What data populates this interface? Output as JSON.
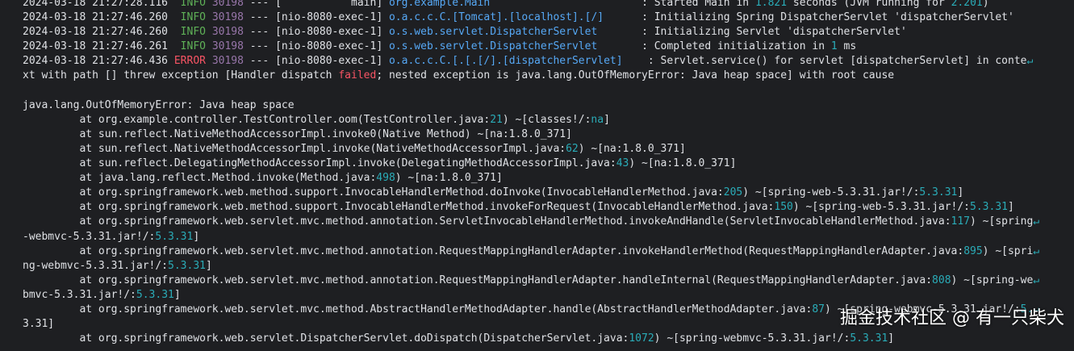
{
  "console": {
    "lines": [
      {
        "kind": "log",
        "ts": "2024-03-18 21:27:28.116",
        "level": "INFO",
        "pid": "30198",
        "thread": "--- [           main]",
        "logger": "org.example.Main",
        "pad": "                        ",
        "msg": ": Started Main in 1.821 seconds (JVM running for 2.201)"
      },
      {
        "kind": "log",
        "ts": "2024-03-18 21:27:46.260",
        "level": "INFO",
        "pid": "30198",
        "thread": "--- [nio-8080-exec-1]",
        "logger": "o.a.c.c.C.[Tomcat].[localhost].[/]",
        "pad": "      ",
        "msg": ": Initializing Spring DispatcherServlet 'dispatcherServlet'"
      },
      {
        "kind": "log",
        "ts": "2024-03-18 21:27:46.260",
        "level": "INFO",
        "pid": "30198",
        "thread": "--- [nio-8080-exec-1]",
        "logger": "o.s.web.servlet.DispatcherServlet",
        "pad": "       ",
        "msg": ": Initializing Servlet 'dispatcherServlet'"
      },
      {
        "kind": "log",
        "ts": "2024-03-18 21:27:46.261",
        "level": "INFO",
        "pid": "30198",
        "thread": "--- [nio-8080-exec-1]",
        "logger": "o.s.web.servlet.DispatcherServlet",
        "pad": "       ",
        "msg": ": Completed initialization in 1 ms"
      },
      {
        "kind": "log",
        "ts": "2024-03-18 21:27:46.436",
        "level": "ERROR",
        "pid": "30198",
        "thread": "--- [nio-8080-exec-1]",
        "logger": "o.a.c.c.C.[.[.[/].[dispatcherServlet]",
        "pad": "    ",
        "msg": ": Servlet.service() for servlet [dispatcherServlet] in conte"
      },
      {
        "kind": "text",
        "text": "xt with path [] threw exception [Handler dispatch failed; nested exception is java.lang.OutOfMemoryError: Java heap space] with root cause"
      },
      {
        "kind": "text",
        "text": ""
      },
      {
        "kind": "text",
        "text": "java.lang.OutOfMemoryError: Java heap space"
      },
      {
        "kind": "text",
        "text": "\tat org.example.controller.TestController.oom(TestController.java:21) ~[classes!/:na]"
      },
      {
        "kind": "text",
        "text": "\tat sun.reflect.NativeMethodAccessorImpl.invoke0(Native Method) ~[na:1.8.0_371]"
      },
      {
        "kind": "text",
        "text": "\tat sun.reflect.NativeMethodAccessorImpl.invoke(NativeMethodAccessorImpl.java:62) ~[na:1.8.0_371]"
      },
      {
        "kind": "text",
        "text": "\tat sun.reflect.DelegatingMethodAccessorImpl.invoke(DelegatingMethodAccessorImpl.java:43) ~[na:1.8.0_371]"
      },
      {
        "kind": "text",
        "text": "\tat java.lang.reflect.Method.invoke(Method.java:498) ~[na:1.8.0_371]"
      },
      {
        "kind": "text",
        "text": "\tat org.springframework.web.method.support.InvocableHandlerMethod.doInvoke(InvocableHandlerMethod.java:205) ~[spring-web-5.3.31.jar!/:5.3.31]"
      },
      {
        "kind": "text",
        "text": "\tat org.springframework.web.method.support.InvocableHandlerMethod.invokeForRequest(InvocableHandlerMethod.java:150) ~[spring-web-5.3.31.jar!/:5.3.31]"
      },
      {
        "kind": "text",
        "text": "\tat org.springframework.web.servlet.mvc.method.annotation.ServletInvocableHandlerMethod.invokeAndHandle(ServletInvocableHandlerMethod.java:117) ~[spring"
      },
      {
        "kind": "cont",
        "text": "-webmvc-5.3.31.jar!/:5.3.31]"
      },
      {
        "kind": "text",
        "text": "\tat org.springframework.web.servlet.mvc.method.annotation.RequestMappingHandlerAdapter.invokeHandlerMethod(RequestMappingHandlerAdapter.java:895) ~[spri"
      },
      {
        "kind": "cont",
        "text": "ng-webmvc-5.3.31.jar!/:5.3.31]"
      },
      {
        "kind": "text",
        "text": "\tat org.springframework.web.servlet.mvc.method.annotation.RequestMappingHandlerAdapter.handleInternal(RequestMappingHandlerAdapter.java:808) ~[spring-we"
      },
      {
        "kind": "cont",
        "text": "bmvc-5.3.31.jar!/:5.3.31]"
      },
      {
        "kind": "text",
        "text": "\tat org.springframework.web.servlet.mvc.method.AbstractHandlerMethodAdapter.handle(AbstractHandlerMethodAdapter.java:87) ~[spring-webmvc-5.3.31.jar!/:5."
      },
      {
        "kind": "cont",
        "text": "3.31]"
      },
      {
        "kind": "text",
        "text": "\tat org.springframework.web.servlet.DispatcherServlet.doDispatch(DispatcherServlet.java:1072) ~[spring-webmvc-5.3.31.jar!/:5.3.31]"
      }
    ],
    "wrap_marker": "↵"
  },
  "watermark": "掘金技术社区 @ 有一只柴犬",
  "colors": {
    "background": "#1e1f22",
    "text": "#dfe1e5",
    "info": "#5fb157",
    "error": "#f75464",
    "pid": "#9876aa",
    "logger": "#56a8f5",
    "number": "#2aacb8"
  }
}
